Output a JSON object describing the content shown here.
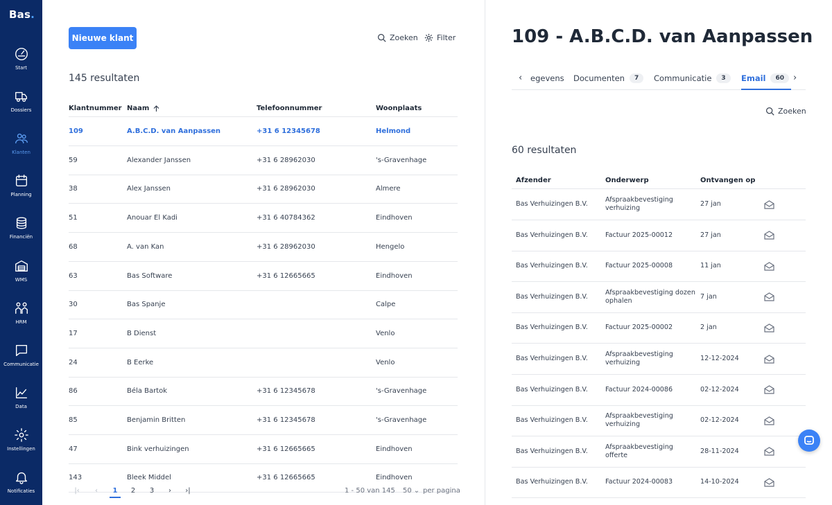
{
  "app": {
    "logo": "Bas",
    "logo_dot": "."
  },
  "nav": [
    {
      "label": "Start",
      "icon": "speedometer-icon"
    },
    {
      "label": "Dossiers",
      "icon": "truck-icon"
    },
    {
      "label": "Klanten",
      "icon": "users-icon",
      "active": true
    },
    {
      "label": "Planning",
      "icon": "calendar-icon"
    },
    {
      "label": "Financiën",
      "icon": "coins-icon"
    },
    {
      "label": "WMS",
      "icon": "warehouse-icon"
    },
    {
      "label": "HRM",
      "icon": "people-icon"
    },
    {
      "label": "Communicatie",
      "icon": "chat-icon"
    },
    {
      "label": "Data",
      "icon": "chart-icon"
    },
    {
      "label": "Instellingen",
      "icon": "gear-icon"
    },
    {
      "label": "Notificaties",
      "icon": "bell-icon"
    }
  ],
  "list": {
    "new_button": "Nieuwe klant",
    "search_label": "Zoeken",
    "filter_label": "Filter",
    "results": "145 resultaten",
    "columns": [
      "Klantnummer",
      "Naam",
      "Telefoonnummer",
      "Woonplaats"
    ],
    "sort_icon": "arrow-up-icon",
    "rows": [
      {
        "nr": "109",
        "naam": "A.B.C.D. van Aanpassen",
        "tel": "+31 6 12345678",
        "plaats": "Helmond",
        "selected": true
      },
      {
        "nr": "59",
        "naam": "Alexander Janssen",
        "tel": "+31 6 28962030",
        "plaats": "'s-Gravenhage"
      },
      {
        "nr": "38",
        "naam": "Alex Janssen",
        "tel": "+31 6 28962030",
        "plaats": "Almere"
      },
      {
        "nr": "51",
        "naam": "Anouar El Kadi",
        "tel": "+31 6 40784362",
        "plaats": "Eindhoven"
      },
      {
        "nr": "68",
        "naam": "A. van Kan",
        "tel": "+31 6 28962030",
        "plaats": "Hengelo"
      },
      {
        "nr": "63",
        "naam": "Bas Software",
        "tel": "+31 6 12665665",
        "plaats": "Eindhoven"
      },
      {
        "nr": "30",
        "naam": "Bas Spanje",
        "tel": "",
        "plaats": "Calpe"
      },
      {
        "nr": "17",
        "naam": "B Dienst",
        "tel": "",
        "plaats": "Venlo"
      },
      {
        "nr": "24",
        "naam": "B Eerke",
        "tel": "",
        "plaats": "Venlo"
      },
      {
        "nr": "86",
        "naam": "Béla Bartok",
        "tel": "+31 6 12345678",
        "plaats": "'s-Gravenhage"
      },
      {
        "nr": "85",
        "naam": "Benjamin Britten",
        "tel": "+31 6 12345678",
        "plaats": "'s-Gravenhage"
      },
      {
        "nr": "47",
        "naam": "Bink verhuizingen",
        "tel": "+31 6 12665665",
        "plaats": "Eindhoven"
      },
      {
        "nr": "143",
        "naam": "Bleek Middel",
        "tel": "+31 6 12665665",
        "plaats": "Eindhoven"
      }
    ],
    "pagination": {
      "pages": [
        "1",
        "2",
        "3"
      ],
      "current": "1",
      "range": "1 - 50 van 145",
      "per_page_value": "50",
      "per_page_label": "per pagina"
    }
  },
  "detail": {
    "title": "109 - A.B.C.D. van Aanpassen",
    "tabs": [
      {
        "label": "egevens",
        "count": ""
      },
      {
        "label": "Documenten",
        "count": "7"
      },
      {
        "label": "Communicatie",
        "count": "3"
      },
      {
        "label": "Email",
        "count": "60",
        "active": true
      }
    ],
    "search_label": "Zoeken",
    "results": "60 resultaten",
    "columns": [
      "Afzender",
      "Onderwerp",
      "Ontvangen op"
    ],
    "emails": [
      {
        "afzender": "Bas Verhuizingen B.V.",
        "onderwerp": "Afspraakbevestiging verhuizing",
        "datum": "27 jan"
      },
      {
        "afzender": "Bas Verhuizingen B.V.",
        "onderwerp": "Factuur 2025-00012",
        "datum": "27 jan"
      },
      {
        "afzender": "Bas Verhuizingen B.V.",
        "onderwerp": "Factuur 2025-00008",
        "datum": "11 jan"
      },
      {
        "afzender": "Bas Verhuizingen B.V.",
        "onderwerp": "Afspraakbevestiging dozen ophalen",
        "datum": "7 jan"
      },
      {
        "afzender": "Bas Verhuizingen B.V.",
        "onderwerp": "Factuur 2025-00002",
        "datum": "2 jan"
      },
      {
        "afzender": "Bas Verhuizingen B.V.",
        "onderwerp": "Afspraakbevestiging verhuizing",
        "datum": "12-12-2024"
      },
      {
        "afzender": "Bas Verhuizingen B.V.",
        "onderwerp": "Factuur 2024-00086",
        "datum": "02-12-2024"
      },
      {
        "afzender": "Bas Verhuizingen B.V.",
        "onderwerp": "Afspraakbevestiging verhuizing",
        "datum": "02-12-2024"
      },
      {
        "afzender": "Bas Verhuizingen B.V.",
        "onderwerp": "Afspraakbevestiging offerte",
        "datum": "28-11-2024"
      },
      {
        "afzender": "Bas Verhuizingen B.V.",
        "onderwerp": "Factuur 2024-00083",
        "datum": "14-10-2024"
      }
    ]
  },
  "colors": {
    "sidebar": "#0b2a66",
    "accent": "#3b82f6",
    "link": "#2f6fdc"
  }
}
